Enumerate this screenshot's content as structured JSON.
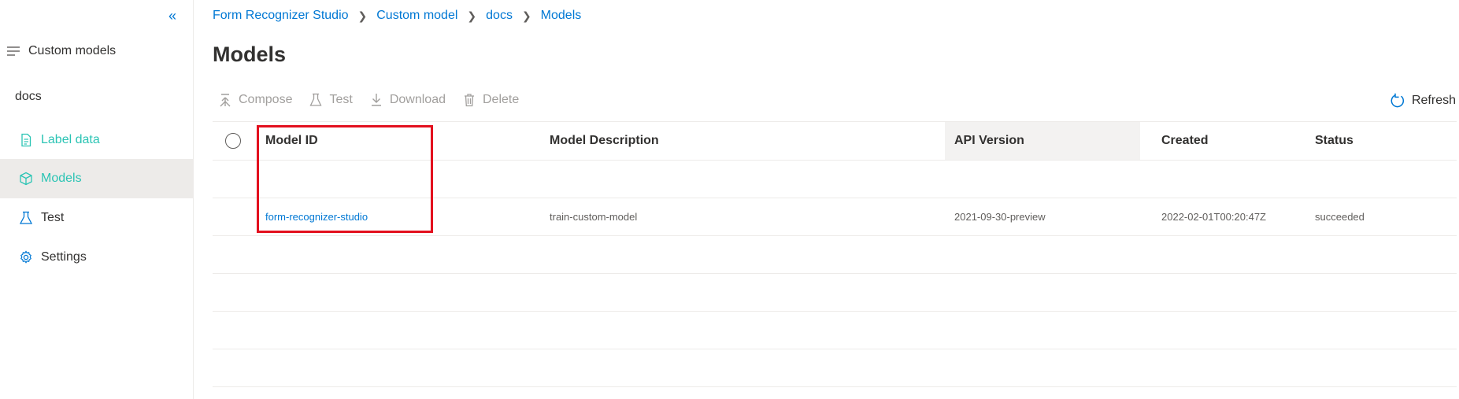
{
  "sidebar": {
    "collapse_glyph": "«",
    "heading": "Custom models",
    "project": "docs",
    "items": [
      {
        "label": "Label data",
        "icon": "document-icon",
        "active": false
      },
      {
        "label": "Models",
        "icon": "cube-icon",
        "active": true
      },
      {
        "label": "Test",
        "icon": "flask-icon",
        "active": false
      },
      {
        "label": "Settings",
        "icon": "gear-icon",
        "active": false
      }
    ]
  },
  "breadcrumb": [
    "Form Recognizer Studio",
    "Custom model",
    "docs",
    "Models"
  ],
  "page_title": "Models",
  "toolbar": {
    "compose": "Compose",
    "test": "Test",
    "download": "Download",
    "delete": "Delete",
    "refresh": "Refresh"
  },
  "table": {
    "headers": {
      "model_id": "Model ID",
      "description": "Model Description",
      "api_version": "API Version",
      "created": "Created",
      "status": "Status"
    },
    "rows": [
      {
        "model_id": "form-recognizer-studio",
        "description": "train-custom-model",
        "api_version": "2021-09-30-preview",
        "created": "2022-02-01T00:20:47Z",
        "status": "succeeded"
      }
    ]
  },
  "colors": {
    "accent": "#0078d4",
    "teal": "#2bc4b4",
    "highlight": "#e3101e"
  }
}
